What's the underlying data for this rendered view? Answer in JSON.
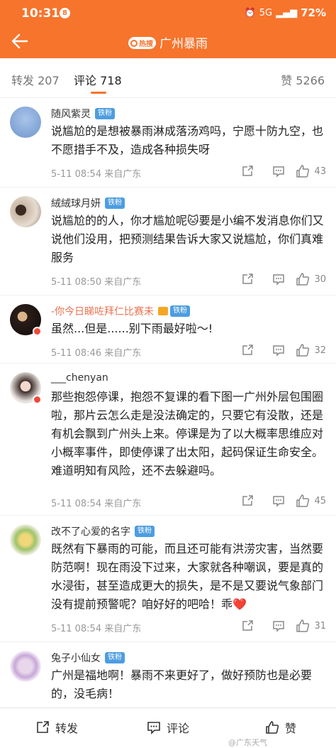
{
  "status_bar": {
    "time": "10:31",
    "notification_count": "8",
    "network": "5G",
    "battery": "72%"
  },
  "header": {
    "hot_badge": "热搜",
    "title": "广州暴雨"
  },
  "tabs": {
    "reposts": "转发 207",
    "comments": "评论 718",
    "likes": "赞 5266"
  },
  "comments": [
    {
      "name": "随风紫灵",
      "badge": "铁粉",
      "text": "说尴尬的是想被暴雨淋成落汤鸡吗，宁愿十防九空，也不愿措手不及，造成各种损失呀",
      "meta": "5-11 08:54  来自广东",
      "likes": "43"
    },
    {
      "name": "絨絨球月妍",
      "badge": "铁粉",
      "text": "说尴尬的的人，你才尴尬呢🐱要是小编不发消息你们又说他们没用，把预测结果告诉大家又说尴尬，你们真难服务",
      "meta": "5-11 08:50  来自广东",
      "likes": "30"
    },
    {
      "name": "-你今日睇咗拜仁比赛未",
      "badge": "铁粉",
      "text": "虽然...但是......别下雨最好啦～!",
      "meta": "5-11 08:46  来自广东",
      "likes": "32"
    },
    {
      "name": "___chenyan",
      "badge": "",
      "text": "那些抱怨停课，抱怨不复课的看下图一广州外层包围圈啦，那片云怎么走是没法确定的，只要它有没散，还是有机会飘到广州头上来。停课是为了以大概率思维应对小概率事件，即使停课了出太阳，起码保证生命安全。难道明知有风险，还不去躲避吗。",
      "meta": "5-11 08:54  来自广东",
      "likes": "45"
    },
    {
      "name": "改不了心爱的名字",
      "badge": "铁粉",
      "text": "既然有下暴雨的可能，而且还可能有洪涝灾害，当然要防范啊！现在雨没下过来，大家就各种嘲讽，要是真的水浸街，甚至造成更大的损失，是不是又要说气象部门没有提前预警呢？咱好好的吧哈！乖❤️",
      "meta": "5-11 08:54  来自广东",
      "likes": "31"
    },
    {
      "name": "兔子小仙女",
      "badge": "铁粉",
      "text": "广州是福地啊！暴雨不来更好了，做好预防也是必要的，没毛病！",
      "meta": "",
      "likes": ""
    }
  ],
  "bottom_bar": {
    "repost": "转发",
    "comment": "评论",
    "like": "赞"
  },
  "watermark": "@广东天气",
  "colors": {
    "brand_orange": "#f7742c",
    "fan_badge_blue": "#4d9de0"
  },
  "icons": [
    "back-arrow-icon",
    "search-icon",
    "share-icon",
    "comment-icon",
    "like-icon"
  ]
}
